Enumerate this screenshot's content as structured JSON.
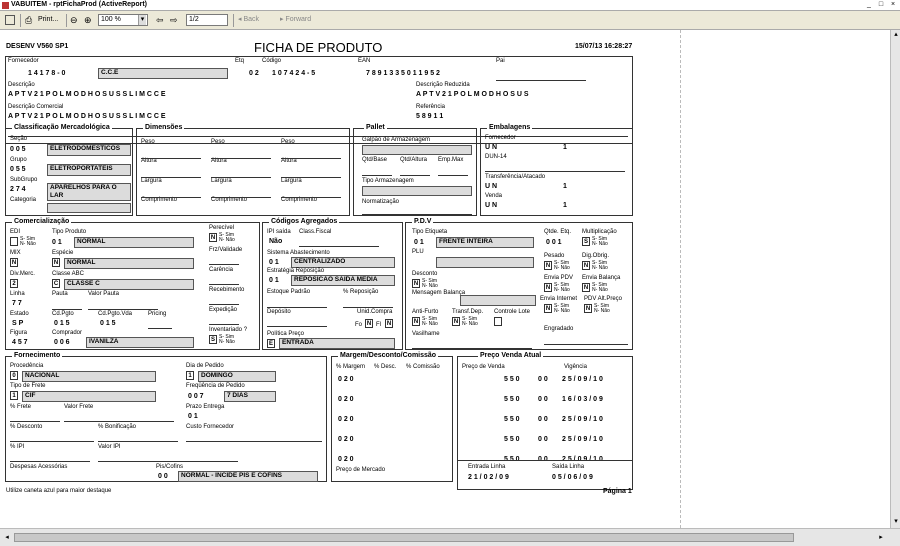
{
  "window": {
    "title": "VABUITEM - rptFichaProd (ActiveReport)",
    "min": "_",
    "max": "□",
    "close": "×"
  },
  "toolbar": {
    "print": "Print...",
    "zoom": "100 %",
    "page": "1/2",
    "back": "Back",
    "forward": "Forward"
  },
  "report": {
    "header_left": "DESENV V560 SP1",
    "title": "FICHA DE PRODUTO",
    "datetime": "15/07/13 16:28:27",
    "fornecedor_label": "Fornecedor",
    "fornecedor_code": "1 4 1 7 8 - 0",
    "fornecedor_name": "C.C.E",
    "etq_label": "Etq",
    "etq_value": "0 2",
    "codigo_label": "Código",
    "codigo_value": "1 0 7 4 2 4 - 5",
    "ean_label": "EAN",
    "ean_value": "7 8 9 1 3 3 5 0 1 1 9 5 2",
    "pai_label": "Pai",
    "descricao_label": "Descrição",
    "descricao_value": "A P   T V   2 1   P O L   M O D H O S   U S   S L I M   C C E",
    "descricao_reduzida_label": "Descrição Reduzida",
    "descricao_reduzida_value": "A P   T V   2 1   P O L   M O D H O S   U S",
    "descricao_comercial_label": "Descrição Comercial",
    "descricao_comercial_value": "A P   T V   2 1   P O L   M O D H O S   U S   S L I M   C C E",
    "referencia_label": "Referência",
    "referencia_value": "5 8 9 1 1",
    "footer_note": "Utilize caneta azul para maior destaque",
    "pagina": "Página 1"
  },
  "classificacao": {
    "title": "Classificação Mercadológica",
    "secao_label": "Seção",
    "secao_code": "0 0 5",
    "secao_name": "ELETRODOMESTICOS",
    "grupo_label": "Grupo",
    "grupo_code": "0 5 5",
    "grupo_name": "ELETROPORTATEIS",
    "subgrupo_label": "SubGrupo",
    "subgrupo_code": "2 7 4",
    "subgrupo_name": "APARELHOS PARA O LAR",
    "categoria_label": "Categoria"
  },
  "dimensoes": {
    "title": "Dimensões",
    "peso": "Peso",
    "altura": "Altura",
    "largura": "Largura",
    "comprimento": "Comprimento"
  },
  "pallet": {
    "title": "Pallet",
    "galpao": "Galpão de Armazenagem",
    "qtd_base": "Qtd/Base",
    "qtd_altura": "Qtd/Altura",
    "emp_max": "Emp.Max",
    "tipo_armazenagem": "Tipo Armazenagem",
    "normatizacao": "Normatização"
  },
  "embalagens": {
    "title": "Embalagens",
    "fornecedor": "Fornecedor",
    "fornecedor_un": "U N",
    "fornecedor_qty": "1",
    "dun14": "DUN-14",
    "transferencia": "Transferência/Atacado",
    "transferencia_un": "U N",
    "transferencia_qty": "1",
    "venda": "Venda",
    "venda_un": "U N",
    "venda_qty": "1"
  },
  "comercializacao": {
    "title": "Comercialização",
    "edi": "EDI",
    "sim_nao": "S- Sim\nN- Não",
    "tipo_produto": "Tipo Produto",
    "tipo_produto_code": "0 1",
    "tipo_produto_name": "NORMAL",
    "mix": "MIX",
    "mix_value": "N",
    "especie": "Espécie",
    "especie_code": "N",
    "especie_name": "NORMAL",
    "div_merc": "Div.Merc.",
    "div_merc_value": "2",
    "classe_abc": "Classe ABC",
    "classe_abc_code": "C",
    "classe_abc_name": "CLASSE C",
    "linha": "Linha",
    "linha_value": "7 7",
    "pauta": "Pauta",
    "valor_pauta": "Valor Pauta",
    "estado": "Estado",
    "estado_value": "S P",
    "cd_pgto": "Cd.Pgto",
    "cd_pgto_value": "0 1 5",
    "cd_pgto_vda": "Cd.Pgto.Vda",
    "cd_pgto_vda_value": "0 1 5",
    "pricing": "Pricing",
    "figura": "Figura",
    "figura_value": "4 5 7",
    "comprador": "Comprador",
    "comprador_code": "0 0 6",
    "comprador_name": "IVANILZA",
    "perecivel": "Perecível",
    "perecivel_value": "N",
    "frz_validade": "Frz/Validade",
    "carencia": "Carência",
    "recebimento": "Recebimento",
    "expedicao": "Expedição",
    "inventariado": "Inventariado ?",
    "inventariado_value": "S"
  },
  "codigos": {
    "title": "Códigos Agregados",
    "ipi_saida": "IPI saída",
    "ipi_value": "Não",
    "class_fiscal": "Class.Fiscal",
    "sistema": "Sistema Abastecimento",
    "sistema_code": "0 1",
    "sistema_name": "CENTRALIZADO",
    "estrategia": "Estratégia Reposição",
    "estrategia_code": "0 1",
    "estrategia_name": "REPOSICAO SAIDA MEDIA",
    "estoque_padrao": "Estoque Padrão",
    "reposicao": "% Reposição",
    "deposito": "Depósito",
    "unid_compra": "Unid.Compra",
    "unid_fo": "Fo",
    "unid_n": "N",
    "unid_fi": "Fl",
    "unid_n2": "N",
    "politica": "Política Preço",
    "politica_code": "E",
    "politica_name": "ENTRADA"
  },
  "pdv": {
    "title": "P.D.V",
    "tipo_etiqueta": "Tipo Etiqueta",
    "tipo_etiqueta_code": "0 1",
    "tipo_etiqueta_name": "FRENTE INTEIRA",
    "qtde_etq": "Qtde. Etq.",
    "qtde_etq_value": "0 0 1",
    "multiplicacao": "Multiplicação",
    "multiplicacao_value": "S",
    "plu": "PLU",
    "pesado": "Pesado",
    "pesado_value": "N",
    "dig_obrig": "Dig.Obrig.",
    "dig_obrig_value": "N",
    "desconto": "Desconto",
    "desconto_value": "N",
    "envia_pdv": "Envia PDV",
    "envia_pdv_value": "N",
    "envia_balanca": "Envia Balança",
    "envia_balanca_value": "N",
    "mensagem_balanca": "Mensagem Balança",
    "envia_internet": "Envia Internet",
    "envia_internet_value": "N",
    "pdv_alt_preco": "PDV Alt.Preço",
    "pdv_alt_preco_value": "N",
    "anti_furto": "Anti-Furto",
    "anti_furto_value": "N",
    "transf_dep": "Transf.Dep.",
    "transf_dep_value": "N",
    "controle_lote": "Controle Lote",
    "vasilhame": "Vasilhame",
    "engradado": "Engradado"
  },
  "fornecimento": {
    "title": "Fornecimento",
    "procedencia": "Procedência",
    "procedencia_code": "0",
    "procedencia_name": "NACIONAL",
    "dia_pedido": "Dia de Pedido",
    "dia_pedido_code": "1",
    "dia_pedido_name": "DOMINGO",
    "tipo_frete": "Tipo de Frete",
    "tipo_frete_code": "1",
    "tipo_frete_name": "CIF",
    "frequencia": "Freqüência de Pedido",
    "frequencia_code": "0 0 7",
    "frequencia_name": "7 DIAS",
    "pct_frete": "% Frete",
    "valor_frete": "Valor Frete",
    "prazo_entrega": "Prazo Entrega",
    "prazo_value": "0 1",
    "pct_desconto": "% Desconto",
    "pct_bonificacao": "% Bonificação",
    "custo_fornecedor": "Custo Fornecedor",
    "pct_ipi": "% IPI",
    "valor_ipi": "Valor IPI",
    "despesas": "Despesas Acessórias",
    "pis_cofins": "Pis/Cofins",
    "pis_code": "0 0",
    "pis_name": "NORMAL - INCIDE PIS E COFINS"
  },
  "margem": {
    "title": "Margem/Desconto/Comissão",
    "margem": "% Margem",
    "desc": "% Desc.",
    "comissao": "% Comissão",
    "rows": [
      "0 2 0",
      "0 2 0",
      "0 2 0",
      "0 2 0",
      "0 2 0"
    ],
    "preco_mercado": "Preço de Mercado"
  },
  "preco": {
    "title": "Preço Venda Atual",
    "preco_venda": "Preço de Venda",
    "vigencia": "Vigência",
    "rows": [
      {
        "price": "5 5 0",
        "cents": "0 0",
        "date": "2 5 / 0 9 / 1 0"
      },
      {
        "price": "5 5 0",
        "cents": "0 0",
        "date": "1 6 / 0 3 / 0 9"
      },
      {
        "price": "5 5 0",
        "cents": "0 0",
        "date": "2 5 / 0 9 / 1 0"
      },
      {
        "price": "5 5 0",
        "cents": "0 0",
        "date": "2 5 / 0 9 / 1 0"
      },
      {
        "price": "5 5 0",
        "cents": "0 0",
        "date": "2 5 / 0 9 / 1 0"
      }
    ],
    "entrada_linha": "Entrada Linha",
    "entrada_value": "2 1 / 0 2 / 0 9",
    "saida_linha": "Saída Linha",
    "saida_value": "0 5 / 0 6 / 0 9"
  }
}
